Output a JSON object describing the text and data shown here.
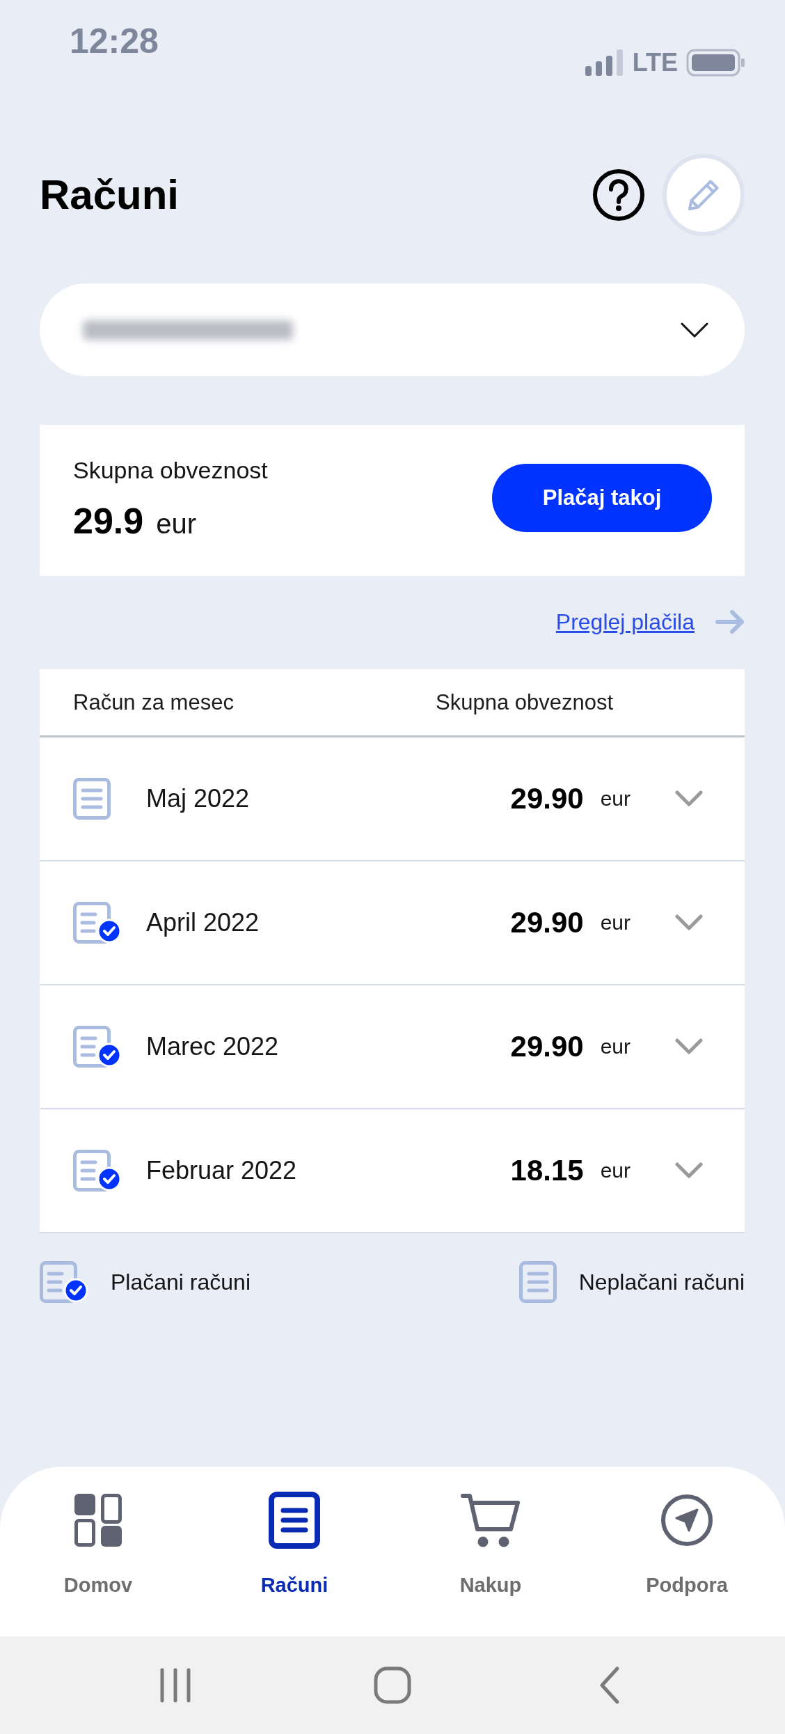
{
  "status_bar": {
    "time": "12:28",
    "network": "LTE"
  },
  "header": {
    "title": "Računi"
  },
  "account_selector": {
    "expanded": false
  },
  "summary": {
    "label": "Skupna obveznost",
    "amount": "29.9",
    "currency": "eur",
    "pay_button": "Plačaj takoj"
  },
  "payments_link": {
    "label": "Preglej plačila"
  },
  "table": {
    "columns": [
      "Račun za mesec",
      "Skupna obveznost"
    ],
    "rows": [
      {
        "month": "Maj 2022",
        "amount": "29.90",
        "currency": "eur",
        "paid": false,
        "expanded": false
      },
      {
        "month": "April 2022",
        "amount": "29.90",
        "currency": "eur",
        "paid": true,
        "expanded": false
      },
      {
        "month": "Marec 2022",
        "amount": "29.90",
        "currency": "eur",
        "paid": true,
        "expanded": false
      },
      {
        "month": "Februar 2022",
        "amount": "18.15",
        "currency": "eur",
        "paid": true,
        "expanded": false
      }
    ]
  },
  "legend": [
    {
      "label": "Plačani računi",
      "paid": true
    },
    {
      "label": "Neplačani računi",
      "paid": false
    }
  ],
  "bottom_nav": [
    {
      "label": "Domov",
      "selected": false
    },
    {
      "label": "Računi",
      "selected": true
    },
    {
      "label": "Nakup",
      "selected": false
    },
    {
      "label": "Podpora",
      "selected": false
    }
  ]
}
